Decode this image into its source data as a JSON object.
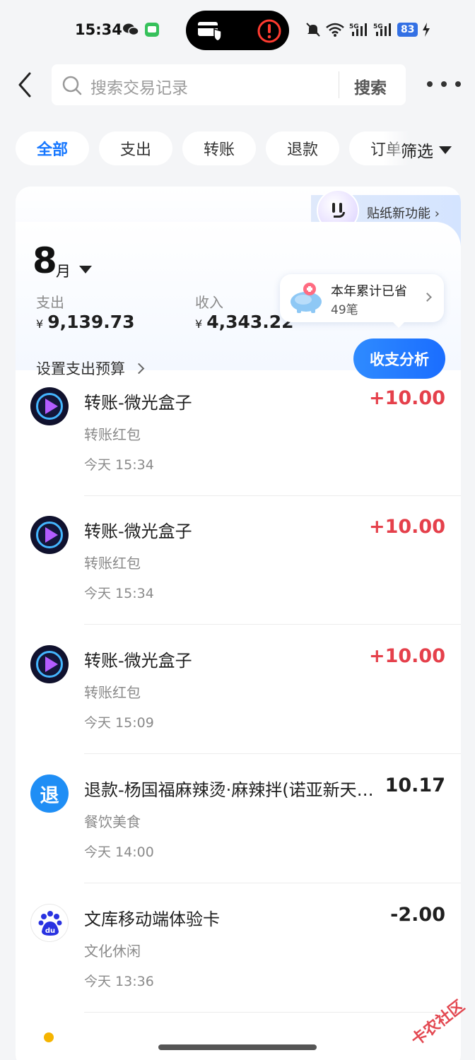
{
  "status_bar": {
    "time": "15:34",
    "battery": "83",
    "icons": [
      "wechat-icon",
      "message-icon",
      "card-shield-icon",
      "alert-icon",
      "mute-icon",
      "wifi-icon",
      "signal-5g-icon",
      "signal-5g-icon",
      "charging-icon"
    ]
  },
  "header": {
    "search_placeholder": "搜索交易记录",
    "search_button": "搜索"
  },
  "tabs": [
    {
      "label": "全部",
      "active": true
    },
    {
      "label": "支出",
      "active": false
    },
    {
      "label": "转账",
      "active": false
    },
    {
      "label": "退款",
      "active": false
    },
    {
      "label": "订单",
      "active": false
    }
  ],
  "filter_label": "筛选",
  "summary": {
    "sticker_label": "贴纸新功能",
    "month_number": "8",
    "month_unit": "月",
    "expense_label": "支出",
    "expense_currency": "¥",
    "expense_value": "9,139.73",
    "income_label": "收入",
    "income_currency": "¥",
    "income_value": "4,343.22",
    "savings_line1": "本年累计已省",
    "savings_line2": "49笔",
    "budget_label": "设置支出预算",
    "analysis_button": "收支分析"
  },
  "transactions": [
    {
      "icon": "video-box-icon",
      "title": "转账-微光盒子",
      "category": "转账红包",
      "time": "今天 15:34",
      "amount": "+10.00",
      "type": "income"
    },
    {
      "icon": "video-box-icon",
      "title": "转账-微光盒子",
      "category": "转账红包",
      "time": "今天 15:34",
      "amount": "+10.00",
      "type": "income"
    },
    {
      "icon": "video-box-icon",
      "title": "转账-微光盒子",
      "category": "转账红包",
      "time": "今天 15:09",
      "amount": "+10.00",
      "type": "income"
    },
    {
      "icon": "refund-icon",
      "icon_text": "退",
      "title": "退款-杨国福麻辣烫·麻辣拌(诺亚新天…",
      "category": "餐饮美食",
      "time": "今天 14:00",
      "amount": "10.17",
      "type": "neutral"
    },
    {
      "icon": "baidu-icon",
      "icon_text": "du",
      "title": "文库移动端体验卡",
      "category": "文化休闲",
      "time": "今天 13:36",
      "amount": "-2.00",
      "type": "expense"
    }
  ],
  "watermark": "卡农社区",
  "colors": {
    "accent": "#1677ff",
    "income": "#e5404b",
    "background": "#f4f5f7"
  }
}
